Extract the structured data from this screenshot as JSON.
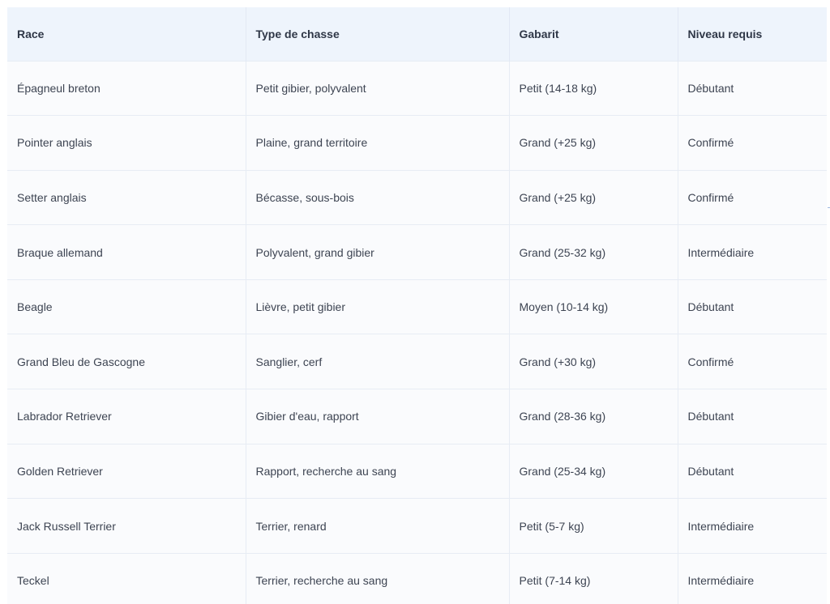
{
  "table": {
    "headers": [
      "Race",
      "Type de chasse",
      "Gabarit",
      "Niveau requis"
    ],
    "rows": [
      [
        "Épagneul breton",
        "Petit gibier, polyvalent",
        "Petit (14-18 kg)",
        "Débutant"
      ],
      [
        "Pointer anglais",
        "Plaine, grand territoire",
        "Grand (+25 kg)",
        "Confirmé"
      ],
      [
        "Setter anglais",
        "Bécasse, sous-bois",
        "Grand (+25 kg)",
        "Confirmé"
      ],
      [
        "Braque allemand",
        "Polyvalent, grand gibier",
        "Grand (25-32 kg)",
        "Intermédiaire"
      ],
      [
        "Beagle",
        "Lièvre, petit gibier",
        "Moyen (10-14 kg)",
        "Débutant"
      ],
      [
        "Grand Bleu de Gascogne",
        "Sanglier, cerf",
        "Grand (+30 kg)",
        "Confirmé"
      ],
      [
        "Labrador Retriever",
        "Gibier d'eau, rapport",
        "Grand (28-36 kg)",
        "Débutant"
      ],
      [
        "Golden Retriever",
        "Rapport, recherche au sang",
        "Grand (25-34 kg)",
        "Débutant"
      ],
      [
        "Jack Russell Terrier",
        "Terrier, renard",
        "Petit (5-7 kg)",
        "Intermédiaire"
      ],
      [
        "Teckel",
        "Terrier, recherche au sang",
        "Petit (7-14 kg)",
        "Intermédiaire"
      ]
    ]
  },
  "colors": {
    "header_bg": "#eef4fc",
    "row_bg": "#fafbfd",
    "border": "#e7ecf4",
    "text": "#3d4452"
  }
}
